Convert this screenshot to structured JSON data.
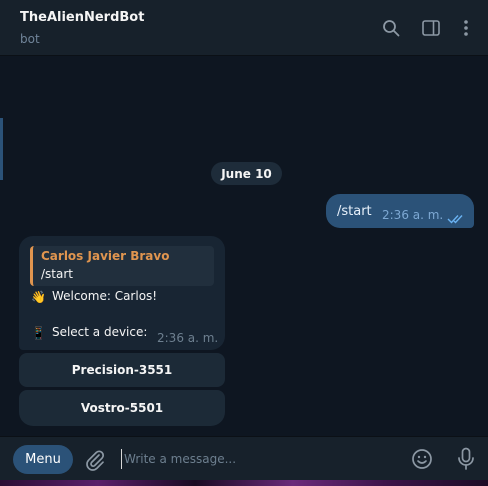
{
  "header": {
    "title": "TheAlienNerdBot",
    "subtitle": "bot",
    "icons": [
      "search-icon",
      "sidebar-toggle-icon",
      "more-vertical-icon"
    ]
  },
  "chat": {
    "date_separator": "June 10",
    "outgoing": {
      "text": "/start",
      "time": "2:36 a. m.",
      "status_icon": "double-check-icon"
    },
    "incoming": {
      "reply_to_name": "Carlos Javier Bravo",
      "reply_to_text": "/start",
      "line1_emoji": "👋",
      "line1": "Welcome: Carlos!",
      "line2_emoji": "📱",
      "line2": "Select a device:",
      "time": "2:36 a. m."
    },
    "keyboard_buttons": [
      "Precision-3551",
      "Vostro-5501"
    ]
  },
  "composer": {
    "menu_label": "Menu",
    "placeholder": "Write a message...",
    "icons": [
      "paperclip-icon",
      "emoji-icon",
      "microphone-icon"
    ]
  },
  "colors": {
    "background": "#0e1621",
    "header": "#17212b",
    "outgoing_bubble": "#2b5278",
    "incoming_bubble": "#182533",
    "accent_name": "#e0954f"
  }
}
